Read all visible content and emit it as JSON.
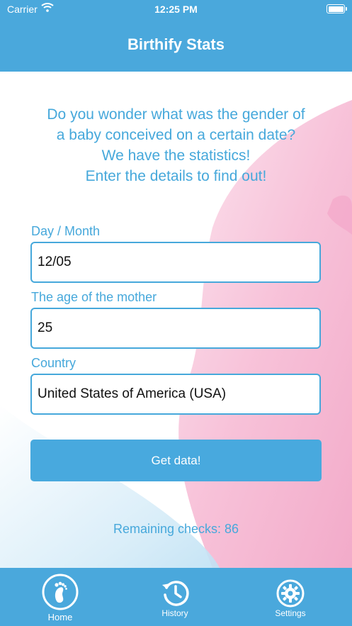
{
  "status_bar": {
    "carrier": "Carrier",
    "time": "12:25 PM"
  },
  "header": {
    "title": "Birthify Stats"
  },
  "intro": {
    "lines": [
      "Do you wonder what was the gender of",
      "a baby conceived on a certain date?",
      "We have the statistics!",
      "Enter the details to find out!"
    ]
  },
  "form": {
    "day_month": {
      "label": "Day / Month",
      "value": "12/05"
    },
    "mother_age": {
      "label": "The age of the mother",
      "value": "25"
    },
    "country": {
      "label": "Country",
      "value": "United States of America (USA)"
    },
    "submit_label": "Get data!"
  },
  "remaining_checks": "Remaining checks: 86",
  "tabs": [
    {
      "label": "Home",
      "icon": "footprint-icon",
      "selected": true
    },
    {
      "label": "History",
      "icon": "history-clock-icon",
      "selected": false
    },
    {
      "label": "Settings",
      "icon": "gear-icon",
      "selected": false
    }
  ],
  "colors": {
    "primary": "#4aa8dc",
    "text_accent": "#46a8db",
    "background_pink": "#f4a8c8",
    "background_blue": "#cfe8f6"
  }
}
